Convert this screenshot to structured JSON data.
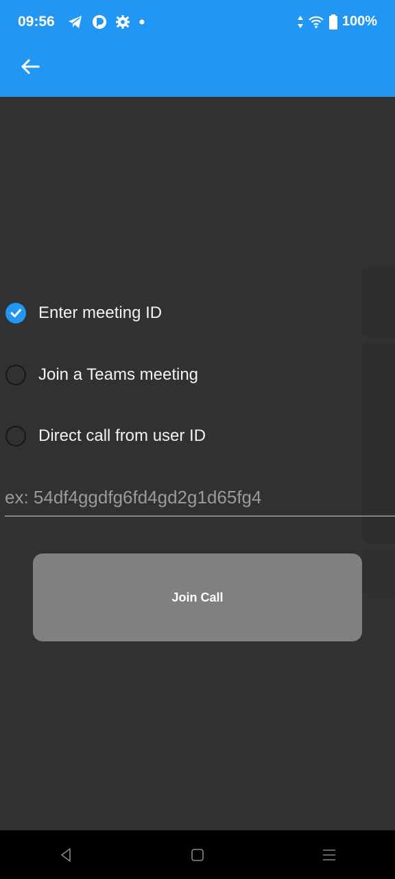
{
  "status_bar": {
    "time": "09:56",
    "battery": "100%",
    "icons_left": [
      "telegram-icon",
      "app-icon",
      "settings-icon",
      "dot-icon"
    ],
    "icons_right": [
      "data-arrows-icon",
      "wifi-icon",
      "battery-icon"
    ]
  },
  "app_bar": {
    "back_icon": "arrow-left-icon",
    "color": "#2196F3"
  },
  "options": [
    {
      "label": "Enter meeting ID",
      "checked": true
    },
    {
      "label": "Join a Teams meeting",
      "checked": false
    },
    {
      "label": "Direct call from user ID",
      "checked": false
    }
  ],
  "input": {
    "placeholder": "ex: 54df4ggdfg6fd4gd2g1d65fg4",
    "value": ""
  },
  "join_button": {
    "label": "Join Call"
  },
  "nav_bar": {
    "icons": [
      "back-icon",
      "home-icon",
      "recents-icon"
    ]
  }
}
